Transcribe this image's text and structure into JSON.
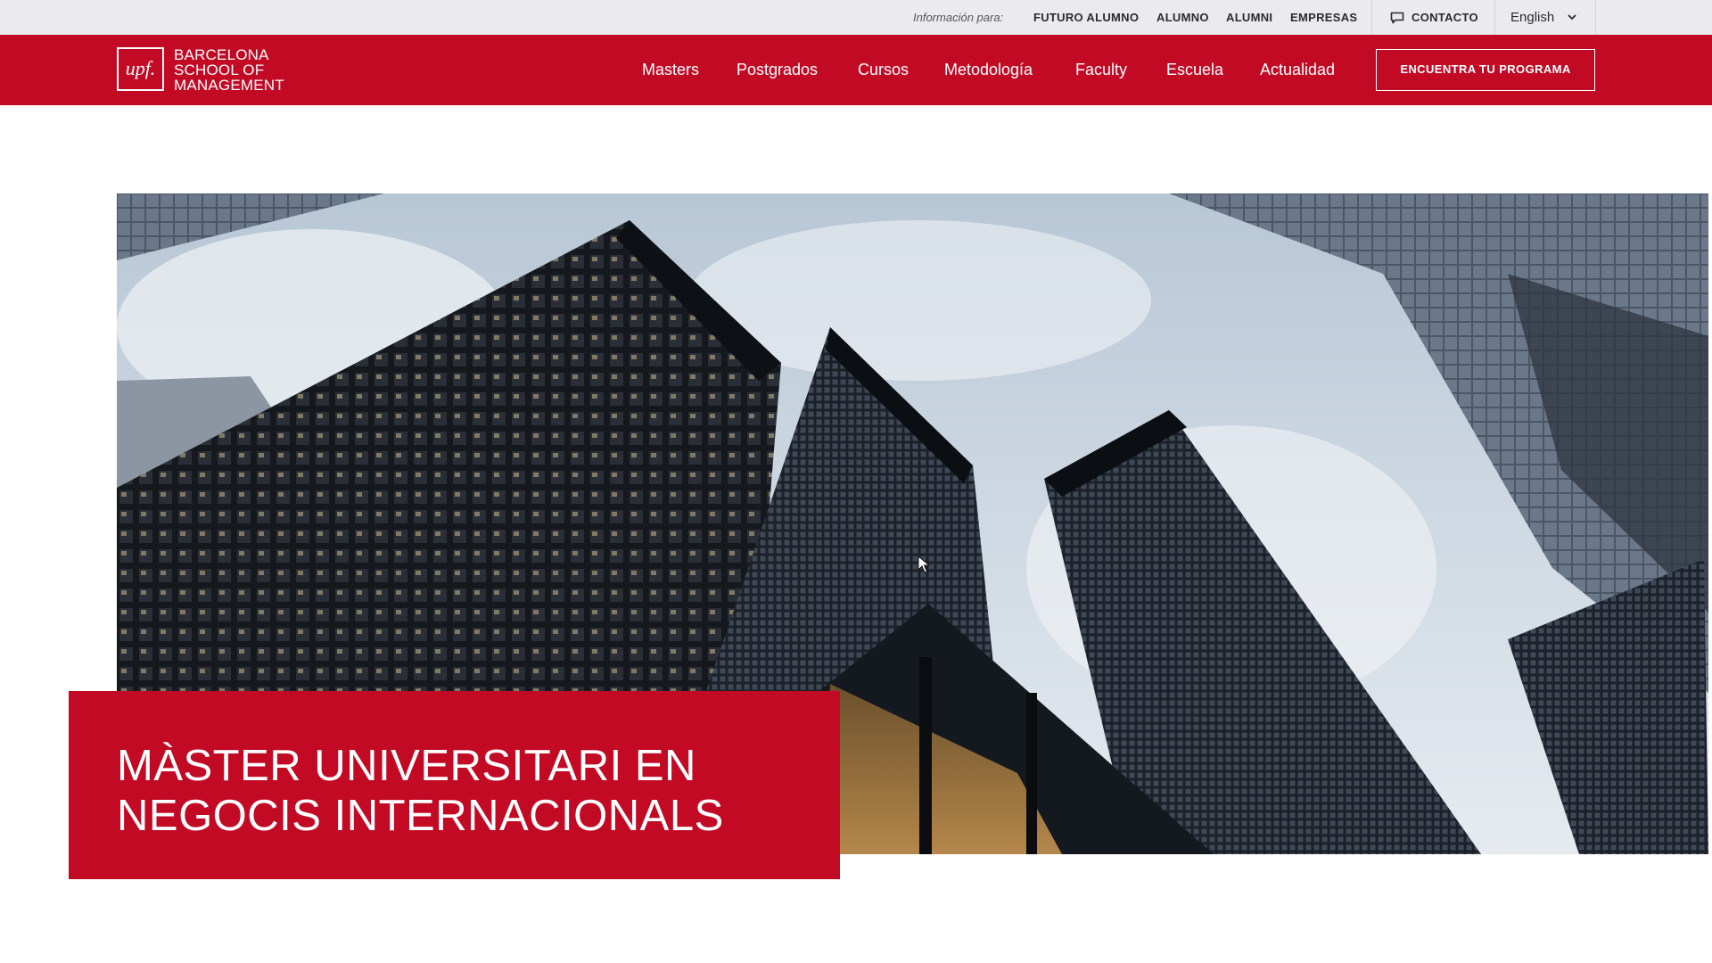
{
  "utility_bar": {
    "info_label": "Información para:",
    "links": [
      "FUTURO ALUMNO",
      "ALUMNO",
      "ALUMNI",
      "EMPRESAS"
    ],
    "contact_label": "CONTACTO",
    "language": "English"
  },
  "header": {
    "logo_mark": "upf.",
    "logo_lines": [
      "BARCELONA",
      "SCHOOL OF",
      "MANAGEMENT"
    ],
    "nav_items": [
      "Masters",
      "Postgrados",
      "Cursos",
      "Metodología",
      "Faculty",
      "Escuela",
      "Actualidad"
    ],
    "cta_label": "ENCUENTRA TU PROGRAMA"
  },
  "hero": {
    "title_lines": [
      "MÀSTER UNIVERSITARI EN",
      "NEGOCIS INTERNACIONALS"
    ]
  },
  "colors": {
    "brand_red": "#c20a25",
    "utility_bg": "#ebebef"
  }
}
